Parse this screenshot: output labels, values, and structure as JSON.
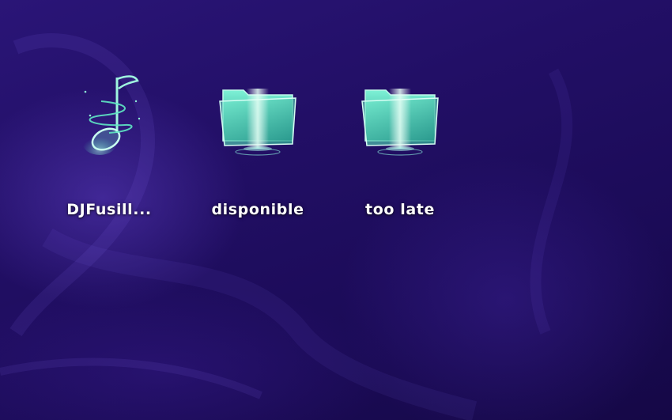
{
  "desktop": {
    "icons": [
      {
        "label": "DJFusill...",
        "icon": "music-note-icon"
      },
      {
        "label": "disponible",
        "icon": "folder-icon"
      },
      {
        "label": "too late",
        "icon": "folder-icon"
      }
    ]
  },
  "colors": {
    "background": "#1e0c5e",
    "icon_glow": "#6ff0d0",
    "label": "#ffffff"
  }
}
